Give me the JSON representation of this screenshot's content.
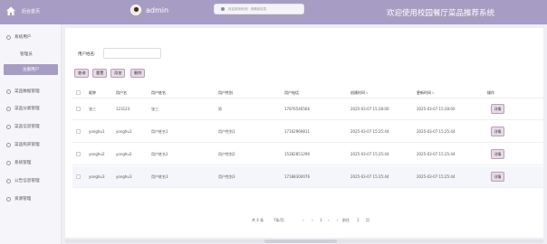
{
  "header": {
    "home_label": "后台首页",
    "user_name": "admin",
    "notice_text": "欢迎使用系统！请确保信息",
    "system_title": "欢迎使用校园餐厅菜品推荐系统",
    "bg_color": "#a79dc4"
  },
  "sidebar": {
    "items": [
      {
        "label": "系统用户",
        "icon": "home-icon"
      },
      {
        "label": "管理员"
      },
      {
        "label": "注册用户"
      },
      {
        "label": "菜品数据管理",
        "icon": "circle-icon"
      },
      {
        "label": "菜品分类管理",
        "icon": "circle-icon"
      },
      {
        "label": "菜品信息管理",
        "icon": "circle-icon"
      },
      {
        "label": "菜品购买管理",
        "icon": "circle-icon"
      },
      {
        "label": "系统管理",
        "icon": "gear-icon"
      },
      {
        "label": "公告信息管理",
        "icon": "circle-icon"
      },
      {
        "label": "资源管理",
        "icon": "list-icon"
      }
    ],
    "active": "注册用户"
  },
  "search": {
    "label": "用户姓名:",
    "value": "",
    "placeholder": ""
  },
  "buttons": {
    "query": "查询",
    "reset": "重置",
    "add": "添加",
    "delete": "删除"
  },
  "table": {
    "columns": [
      "昵称",
      "用户名",
      "用户姓名",
      "用户性别",
      "用户电话",
      "创建时间",
      "更新时间",
      "操作"
    ],
    "rows": [
      {
        "nickname": "张三",
        "username": "123123",
        "real_name": "张三",
        "gender": "男",
        "phone": "17876546566",
        "created": "2025-03-07 15:28:00",
        "updated": "2025-03-07 15:28:00",
        "action": "详情"
      },
      {
        "nickname": "yonghu1",
        "username": "yonghu1",
        "real_name": "用户姓名1",
        "gender": "用户性别1",
        "phone": "17162969811",
        "created": "2025-03-07 15:25:44",
        "updated": "2025-03-07 15:25:44",
        "action": "详情"
      },
      {
        "nickname": "yonghu2",
        "username": "yonghu2",
        "real_name": "用户姓名2",
        "gender": "用户性别2",
        "phone": "15282851296",
        "created": "2025-03-07 15:25:44",
        "updated": "2025-03-07 15:25:44",
        "action": "详情"
      },
      {
        "nickname": "yonghu3",
        "username": "yonghu3",
        "real_name": "用户姓名3",
        "gender": "用户性别3",
        "phone": "17188300076",
        "created": "2025-03-07 15:25:44",
        "updated": "2025-03-07 15:25:44",
        "action": "详情"
      }
    ]
  },
  "pager": {
    "total": "共 4 条",
    "page_size": "7条/页",
    "current_page": "1",
    "goto_label": "前往",
    "goto_value": "1",
    "page_suffix": "页"
  }
}
